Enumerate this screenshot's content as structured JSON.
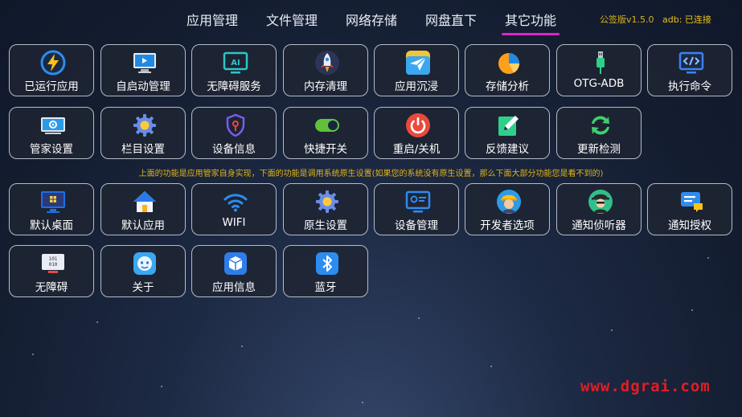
{
  "nav": {
    "tabs": [
      {
        "label": "应用管理",
        "active": false
      },
      {
        "label": "文件管理",
        "active": false
      },
      {
        "label": "网络存储",
        "active": false
      },
      {
        "label": "网盘直下",
        "active": false
      },
      {
        "label": "其它功能",
        "active": true
      }
    ],
    "version": "公签版v1.5.0",
    "adb_status": "adb: 已连接"
  },
  "accent_color": "#e023c8",
  "row1": [
    {
      "label": "已运行应用",
      "icon": "lightning-icon"
    },
    {
      "label": "自启动管理",
      "icon": "monitor-play-icon"
    },
    {
      "label": "无障碍服务",
      "icon": "ai-screen-icon"
    },
    {
      "label": "内存清理",
      "icon": "rocket-icon"
    },
    {
      "label": "应用沉浸",
      "icon": "paper-plane-icon"
    },
    {
      "label": "存储分析",
      "icon": "pie-chart-icon"
    },
    {
      "label": "OTG-ADB",
      "icon": "usb-icon"
    },
    {
      "label": "执行命令",
      "icon": "code-icon"
    }
  ],
  "row2": [
    {
      "label": "管家设置",
      "icon": "settings-screen-icon"
    },
    {
      "label": "栏目设置",
      "icon": "gear-icon"
    },
    {
      "label": "设备信息",
      "icon": "shield-key-icon"
    },
    {
      "label": "快捷开关",
      "icon": "toggle-icon"
    },
    {
      "label": "重启/关机",
      "icon": "power-icon"
    },
    {
      "label": "反馈建议",
      "icon": "edit-icon"
    },
    {
      "label": "更新检测",
      "icon": "refresh-icon"
    }
  ],
  "notice": "上面的功能是应用管家自身实现，下面的功能是调用系统原生设置(如果您的系统没有原生设置，那么下面大部分功能您是看不到的)",
  "row3": [
    {
      "label": "默认桌面",
      "icon": "desktop-icon"
    },
    {
      "label": "默认应用",
      "icon": "home-icon"
    },
    {
      "label": "WIFI",
      "icon": "wifi-icon"
    },
    {
      "label": "原生设置",
      "icon": "gear-icon"
    },
    {
      "label": "设备管理",
      "icon": "device-manage-icon"
    },
    {
      "label": "开发者选项",
      "icon": "developer-icon"
    },
    {
      "label": "通知侦听器",
      "icon": "spy-icon"
    },
    {
      "label": "通知授权",
      "icon": "message-icon"
    }
  ],
  "row4": [
    {
      "label": "无障碍",
      "icon": "binary-screen-icon"
    },
    {
      "label": "关于",
      "icon": "robot-face-icon"
    },
    {
      "label": "应用信息",
      "icon": "package-icon"
    },
    {
      "label": "蓝牙",
      "icon": "bluetooth-icon"
    }
  ],
  "watermark": "www.dgrai.com"
}
